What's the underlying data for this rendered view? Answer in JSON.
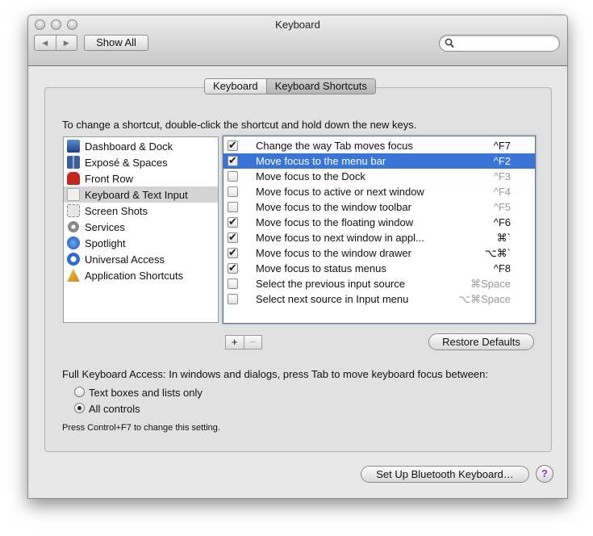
{
  "window": {
    "title": "Keyboard"
  },
  "toolbar": {
    "back_icon": "triangle-left-icon",
    "forward_icon": "triangle-right-icon",
    "show_all_label": "Show All",
    "search_value": ""
  },
  "tabs": [
    {
      "label": "Keyboard",
      "selected": false
    },
    {
      "label": "Keyboard Shortcuts",
      "selected": true
    }
  ],
  "instructions": "To change a shortcut, double-click the shortcut and hold down the new keys.",
  "categories": [
    {
      "label": "Dashboard & Dock",
      "icon": "dashboard-icon",
      "selected": false
    },
    {
      "label": "Exposé & Spaces",
      "icon": "spaces-icon",
      "selected": false
    },
    {
      "label": "Front Row",
      "icon": "front-row-icon",
      "selected": false
    },
    {
      "label": "Keyboard & Text Input",
      "icon": "keyboard-text-input-icon",
      "selected": true
    },
    {
      "label": "Screen Shots",
      "icon": "screen-shots-icon",
      "selected": false
    },
    {
      "label": "Services",
      "icon": "gear-icon",
      "selected": false
    },
    {
      "label": "Spotlight",
      "icon": "spotlight-icon",
      "selected": false
    },
    {
      "label": "Universal Access",
      "icon": "universal-access-icon",
      "selected": false
    },
    {
      "label": "Application Shortcuts",
      "icon": "app-store-icon",
      "selected": false
    }
  ],
  "shortcuts": [
    {
      "checked": true,
      "label": "Change the way Tab moves focus",
      "key": "^F7",
      "dim": false,
      "selected": false
    },
    {
      "checked": true,
      "label": "Move focus to the menu bar",
      "key": "^F2",
      "dim": false,
      "selected": true
    },
    {
      "checked": false,
      "label": "Move focus to the Dock",
      "key": "^F3",
      "dim": true,
      "selected": false
    },
    {
      "checked": false,
      "label": "Move focus to active or next window",
      "key": "^F4",
      "dim": true,
      "selected": false
    },
    {
      "checked": false,
      "label": "Move focus to the window toolbar",
      "key": "^F5",
      "dim": true,
      "selected": false
    },
    {
      "checked": true,
      "label": "Move focus to the floating window",
      "key": "^F6",
      "dim": false,
      "selected": false
    },
    {
      "checked": true,
      "label": "Move focus to next window in appl...",
      "key": "⌘`",
      "dim": false,
      "selected": false
    },
    {
      "checked": true,
      "label": "Move focus to the window drawer",
      "key": "⌥⌘`",
      "dim": false,
      "selected": false
    },
    {
      "checked": true,
      "label": "Move focus to status menus",
      "key": "^F8",
      "dim": false,
      "selected": false
    },
    {
      "checked": false,
      "label": "Select the previous input source",
      "key": "⌘Space",
      "dim": true,
      "selected": false
    },
    {
      "checked": false,
      "label": "Select next source in Input menu",
      "key": "⌥⌘Space",
      "dim": true,
      "selected": false
    }
  ],
  "list_controls": {
    "add_label": "+",
    "remove_label": "−"
  },
  "restore_defaults_label": "Restore Defaults",
  "full_keyboard_access": {
    "label": "Full Keyboard Access: In windows and dialogs, press Tab to move keyboard focus between:",
    "options": [
      {
        "label": "Text boxes and lists only",
        "selected": false
      },
      {
        "label": "All controls",
        "selected": true
      }
    ],
    "note": "Press Control+F7 to change this setting."
  },
  "bluetooth_button_label": "Set Up Bluetooth Keyboard…",
  "help_label": "?",
  "colors": {
    "selection": "#3875d7",
    "help": "#7a3cb7"
  }
}
